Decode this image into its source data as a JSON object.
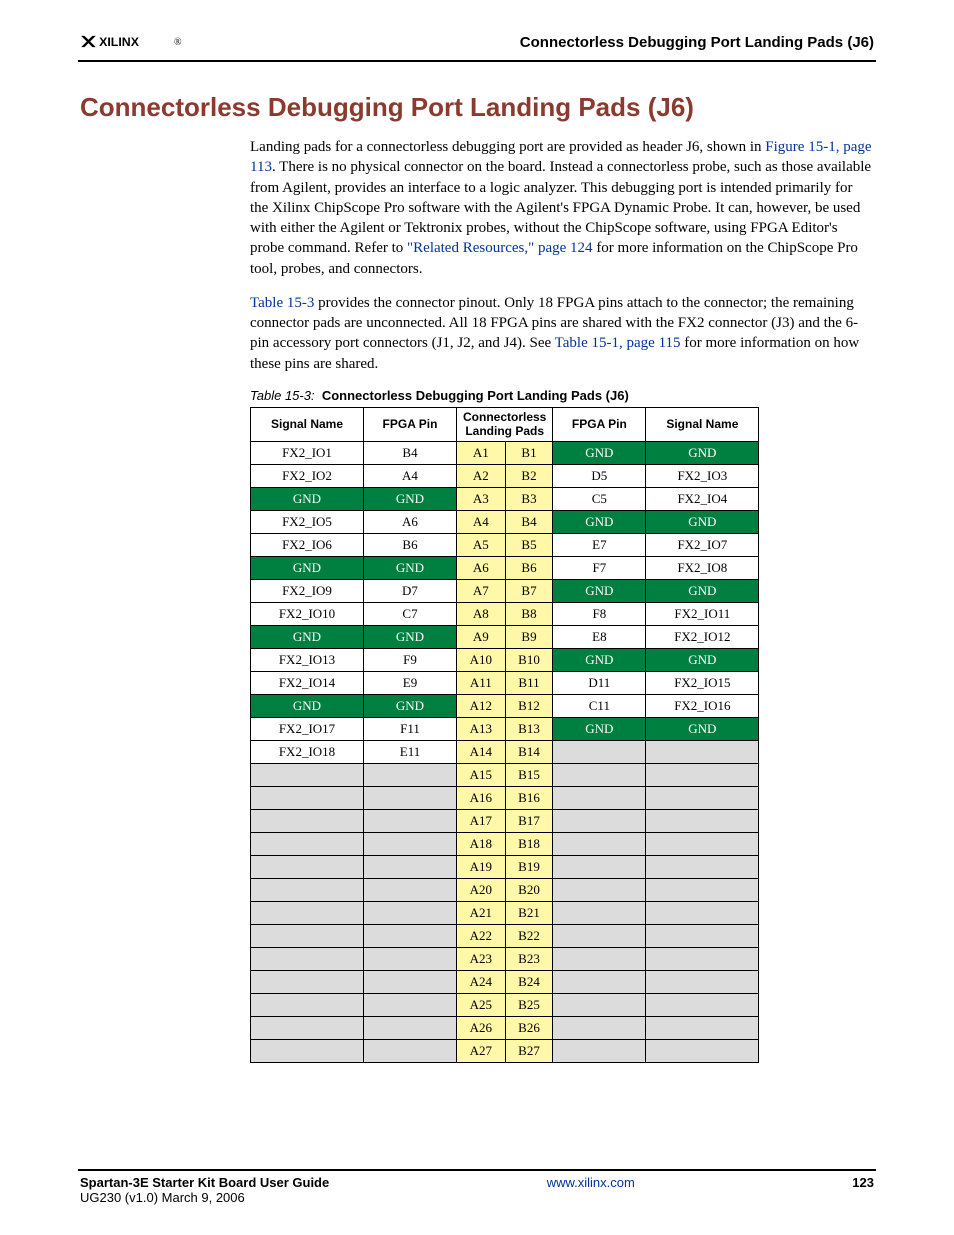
{
  "header": {
    "logo_text": "XILINX",
    "section_title": "Connectorless Debugging Port Landing Pads (J6)"
  },
  "title": "Connectorless Debugging Port Landing Pads (J6)",
  "para1": {
    "t1": "Landing pads for a connectorless debugging port are provided as header J6, shown in ",
    "link1": "Figure 15-1, page 113",
    "t2": ". There is no physical connector on the board. Instead a connectorless probe, such as those available from Agilent, provides an interface to a logic analyzer. This debugging port is intended primarily for the Xilinx ChipScope Pro software with the Agilent's FPGA Dynamic Probe. It can, however, be used with either the Agilent or Tektronix probes, without the ChipScope software, using FPGA Editor's probe command. Refer to ",
    "link2": "\"Related Resources,\" page 124",
    "t3": " for more information on the ChipScope Pro tool, probes, and connectors."
  },
  "para2": {
    "link1": "Table 15-3",
    "t1": " provides the connector pinout. Only 18 FPGA pins attach to the connector; the remaining connector pads are unconnected. All 18 FPGA pins are shared with the FX2 connector (J3) and the 6-pin accessory port connectors (J1, J2, and J4). See ",
    "link2": "Table 15-1, page 115",
    "t2": " for more information on how these pins are shared."
  },
  "table": {
    "caption_label": "Table 15-3:",
    "caption_text": "Connectorless Debugging Port Landing Pads (J6)",
    "headers": {
      "signal_name": "Signal Name",
      "fpga_pin": "FPGA Pin",
      "landing_pads": "Connectorless Landing Pads"
    },
    "rows": [
      {
        "l_sig": "FX2_IO1",
        "l_pin": "B4",
        "a": "A1",
        "b": "B1",
        "r_pin": "GND",
        "r_sig": "GND",
        "l_gnd": false,
        "r_gnd": true
      },
      {
        "l_sig": "FX2_IO2",
        "l_pin": "A4",
        "a": "A2",
        "b": "B2",
        "r_pin": "D5",
        "r_sig": "FX2_IO3",
        "l_gnd": false,
        "r_gnd": false
      },
      {
        "l_sig": "GND",
        "l_pin": "GND",
        "a": "A3",
        "b": "B3",
        "r_pin": "C5",
        "r_sig": "FX2_IO4",
        "l_gnd": true,
        "r_gnd": false
      },
      {
        "l_sig": "FX2_IO5",
        "l_pin": "A6",
        "a": "A4",
        "b": "B4",
        "r_pin": "GND",
        "r_sig": "GND",
        "l_gnd": false,
        "r_gnd": true
      },
      {
        "l_sig": "FX2_IO6",
        "l_pin": "B6",
        "a": "A5",
        "b": "B5",
        "r_pin": "E7",
        "r_sig": "FX2_IO7",
        "l_gnd": false,
        "r_gnd": false
      },
      {
        "l_sig": "GND",
        "l_pin": "GND",
        "a": "A6",
        "b": "B6",
        "r_pin": "F7",
        "r_sig": "FX2_IO8",
        "l_gnd": true,
        "r_gnd": false
      },
      {
        "l_sig": "FX2_IO9",
        "l_pin": "D7",
        "a": "A7",
        "b": "B7",
        "r_pin": "GND",
        "r_sig": "GND",
        "l_gnd": false,
        "r_gnd": true
      },
      {
        "l_sig": "FX2_IO10",
        "l_pin": "C7",
        "a": "A8",
        "b": "B8",
        "r_pin": "F8",
        "r_sig": "FX2_IO11",
        "l_gnd": false,
        "r_gnd": false
      },
      {
        "l_sig": "GND",
        "l_pin": "GND",
        "a": "A9",
        "b": "B9",
        "r_pin": "E8",
        "r_sig": "FX2_IO12",
        "l_gnd": true,
        "r_gnd": false
      },
      {
        "l_sig": "FX2_IO13",
        "l_pin": "F9",
        "a": "A10",
        "b": "B10",
        "r_pin": "GND",
        "r_sig": "GND",
        "l_gnd": false,
        "r_gnd": true
      },
      {
        "l_sig": "FX2_IO14",
        "l_pin": "E9",
        "a": "A11",
        "b": "B11",
        "r_pin": "D11",
        "r_sig": "FX2_IO15",
        "l_gnd": false,
        "r_gnd": false
      },
      {
        "l_sig": "GND",
        "l_pin": "GND",
        "a": "A12",
        "b": "B12",
        "r_pin": "C11",
        "r_sig": "FX2_IO16",
        "l_gnd": true,
        "r_gnd": false
      },
      {
        "l_sig": "FX2_IO17",
        "l_pin": "F11",
        "a": "A13",
        "b": "B13",
        "r_pin": "GND",
        "r_sig": "GND",
        "l_gnd": false,
        "r_gnd": true
      },
      {
        "l_sig": "FX2_IO18",
        "l_pin": "E11",
        "a": "A14",
        "b": "B14",
        "r_pin": "",
        "r_sig": "",
        "l_gnd": false,
        "r_gnd": false,
        "r_empty": true
      },
      {
        "l_sig": "",
        "l_pin": "",
        "a": "A15",
        "b": "B15",
        "r_pin": "",
        "r_sig": "",
        "l_empty": true,
        "r_empty": true
      },
      {
        "l_sig": "",
        "l_pin": "",
        "a": "A16",
        "b": "B16",
        "r_pin": "",
        "r_sig": "",
        "l_empty": true,
        "r_empty": true
      },
      {
        "l_sig": "",
        "l_pin": "",
        "a": "A17",
        "b": "B17",
        "r_pin": "",
        "r_sig": "",
        "l_empty": true,
        "r_empty": true
      },
      {
        "l_sig": "",
        "l_pin": "",
        "a": "A18",
        "b": "B18",
        "r_pin": "",
        "r_sig": "",
        "l_empty": true,
        "r_empty": true
      },
      {
        "l_sig": "",
        "l_pin": "",
        "a": "A19",
        "b": "B19",
        "r_pin": "",
        "r_sig": "",
        "l_empty": true,
        "r_empty": true
      },
      {
        "l_sig": "",
        "l_pin": "",
        "a": "A20",
        "b": "B20",
        "r_pin": "",
        "r_sig": "",
        "l_empty": true,
        "r_empty": true
      },
      {
        "l_sig": "",
        "l_pin": "",
        "a": "A21",
        "b": "B21",
        "r_pin": "",
        "r_sig": "",
        "l_empty": true,
        "r_empty": true
      },
      {
        "l_sig": "",
        "l_pin": "",
        "a": "A22",
        "b": "B22",
        "r_pin": "",
        "r_sig": "",
        "l_empty": true,
        "r_empty": true
      },
      {
        "l_sig": "",
        "l_pin": "",
        "a": "A23",
        "b": "B23",
        "r_pin": "",
        "r_sig": "",
        "l_empty": true,
        "r_empty": true
      },
      {
        "l_sig": "",
        "l_pin": "",
        "a": "A24",
        "b": "B24",
        "r_pin": "",
        "r_sig": "",
        "l_empty": true,
        "r_empty": true
      },
      {
        "l_sig": "",
        "l_pin": "",
        "a": "A25",
        "b": "B25",
        "r_pin": "",
        "r_sig": "",
        "l_empty": true,
        "r_empty": true
      },
      {
        "l_sig": "",
        "l_pin": "",
        "a": "A26",
        "b": "B26",
        "r_pin": "",
        "r_sig": "",
        "l_empty": true,
        "r_empty": true
      },
      {
        "l_sig": "",
        "l_pin": "",
        "a": "A27",
        "b": "B27",
        "r_pin": "",
        "r_sig": "",
        "l_empty": true,
        "r_empty": true
      }
    ]
  },
  "footer": {
    "left_title": "Spartan-3E Starter Kit Board User Guide",
    "left_sub": "UG230 (v1.0) March 9, 2006",
    "center_link": "www.xilinx.com",
    "page_num": "123"
  }
}
